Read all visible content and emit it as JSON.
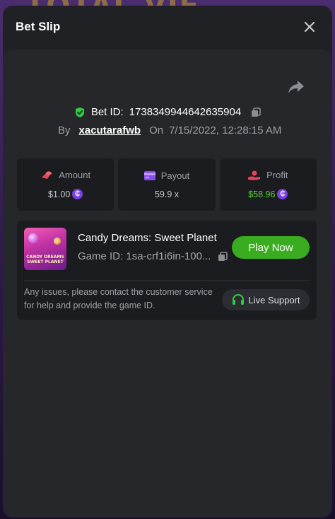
{
  "background": {
    "title_text": "TOTAL VIE"
  },
  "header": {
    "title": "Bet Slip",
    "close_icon": "close-icon"
  },
  "bet": {
    "id_label": "Bet ID:",
    "id_value": "1738349944642635904",
    "by_label": "By",
    "username": "xacutarafwb",
    "on_label": "On",
    "date": "7/15/2022, 12:28:15 AM"
  },
  "stats": [
    {
      "key": "amount",
      "label": "Amount",
      "icon": "coins-icon",
      "value": "$1.00",
      "has_coin": true,
      "color": "#c8c9cc"
    },
    {
      "key": "payout",
      "label": "Payout",
      "icon": "card-icon",
      "value": "59.9 x",
      "has_coin": false,
      "color": "#c8c9cc"
    },
    {
      "key": "profit",
      "label": "Profit",
      "icon": "hand-coin-icon",
      "value": "$58.96",
      "has_coin": true,
      "color": "#5ad33a"
    }
  ],
  "game": {
    "name": "Candy Dreams: Sweet Planet",
    "id_text": "Game ID: 1sa-crf1i6in-100...",
    "thumb_text": "CANDY DREAMS SWEET PLANET",
    "play_label": "Play Now"
  },
  "support": {
    "message": "Any issues, please contact the customer service for help and provide the game ID.",
    "button_label": "Live Support"
  },
  "colors": {
    "accent_green": "#3aac1f",
    "coin_purple": "#7b3fe4",
    "verified_green": "#2ecc40",
    "amount_icon": "#e8465a",
    "payout_icon": "#8a4ef0",
    "profit_icon": "#e8465a"
  }
}
